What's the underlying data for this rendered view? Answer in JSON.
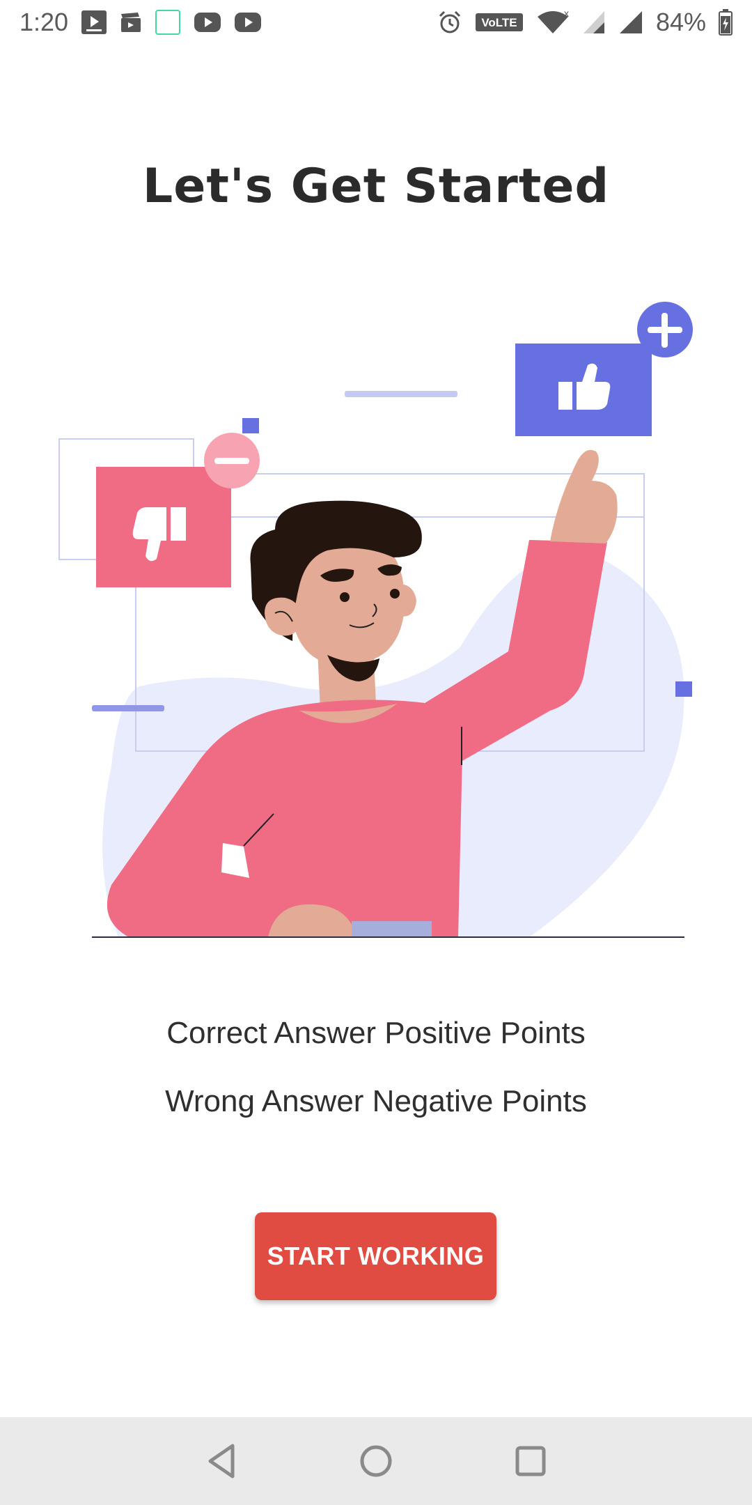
{
  "status_bar": {
    "time": "1:20",
    "battery_percent": "84%",
    "network_label": "VoLTE",
    "left_icons": [
      "media-player-icon",
      "clapperboard-icon",
      "square-notification-icon",
      "youtube-icon",
      "youtube-icon"
    ],
    "right_icons": [
      "alarm-icon",
      "volte-icon",
      "wifi-icon",
      "cellular-no-signal-icon",
      "cellular-signal-icon",
      "battery-icon"
    ]
  },
  "title": "Let's Get Started",
  "illustration": {
    "icons": [
      "thumbs-up-icon",
      "thumbs-down-icon",
      "plus-icon",
      "minus-icon"
    ],
    "colors": {
      "accent_blue": "#6670e0",
      "accent_pink": "#f06b84",
      "blob": "#e8ecfc",
      "skin": "#e3ab95",
      "hair": "#24150f"
    }
  },
  "rules": {
    "correct": "Correct Answer Positive Points",
    "wrong": "Wrong Answer Negative Points"
  },
  "start_button": {
    "label": "START WORKING",
    "color": "#e04b42"
  },
  "nav_bar": {
    "buttons": [
      "back-icon",
      "home-icon",
      "recents-icon"
    ]
  }
}
